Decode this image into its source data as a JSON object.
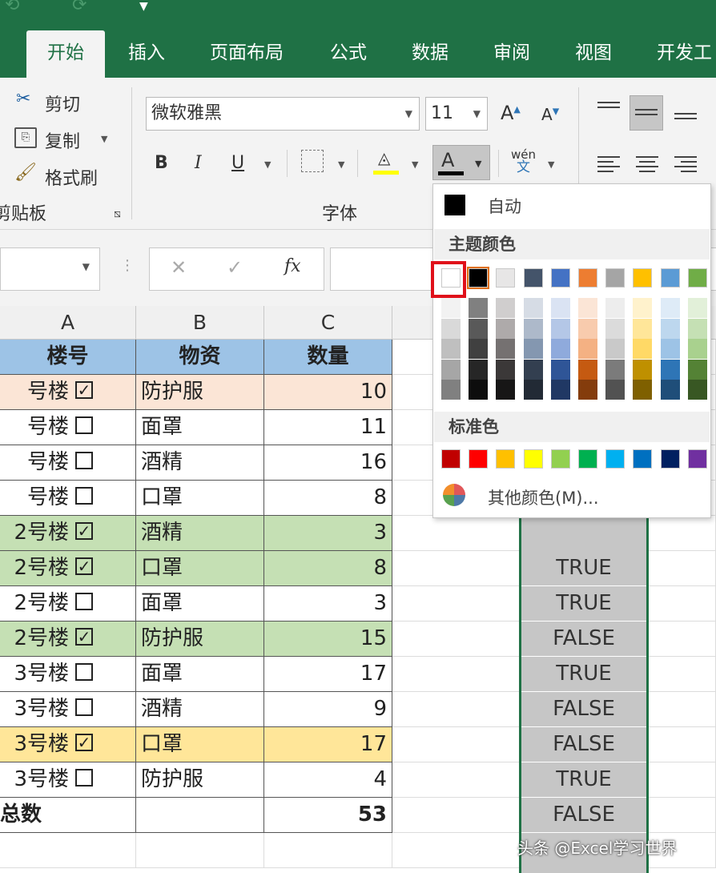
{
  "ribbon": {
    "tabs": [
      "开始",
      "插入",
      "页面布局",
      "公式",
      "数据",
      "审阅",
      "视图",
      "开发工"
    ],
    "clipboard": {
      "cut": "剪切",
      "copy": "复制",
      "format_painter": "格式刷",
      "group_label": "剪贴板"
    },
    "font": {
      "font_name": "微软雅黑",
      "font_size": "11",
      "bold": "B",
      "italic": "I",
      "underline": "U",
      "increase": "A",
      "decrease": "A",
      "font_color": "A",
      "phonetic_top": "wén",
      "phonetic_bottom": "文",
      "group_label": "字体"
    }
  },
  "formula_bar": {
    "cancel": "✕",
    "confirm": "✓",
    "fx": "fx"
  },
  "columns": [
    "A",
    "B",
    "C"
  ],
  "table": {
    "headers": [
      "楼号",
      "物资",
      "数量"
    ],
    "rows": [
      {
        "building": "号楼",
        "checked": true,
        "item": "防护服",
        "qty": "10",
        "bg": "#fbe5d6"
      },
      {
        "building": "号楼",
        "checked": false,
        "item": "面罩",
        "qty": "11",
        "bg": "#ffffff"
      },
      {
        "building": "号楼",
        "checked": false,
        "item": "酒精",
        "qty": "16",
        "bg": "#ffffff"
      },
      {
        "building": "号楼",
        "checked": false,
        "item": "口罩",
        "qty": "8",
        "bg": "#ffffff"
      },
      {
        "building": "2号楼",
        "checked": true,
        "item": "酒精",
        "qty": "3",
        "bg": "#c5e0b4"
      },
      {
        "building": "2号楼",
        "checked": true,
        "item": "口罩",
        "qty": "8",
        "bg": "#c5e0b4"
      },
      {
        "building": "2号楼",
        "checked": false,
        "item": "面罩",
        "qty": "3",
        "bg": "#ffffff"
      },
      {
        "building": "2号楼",
        "checked": true,
        "item": "防护服",
        "qty": "15",
        "bg": "#c5e0b4"
      },
      {
        "building": "3号楼",
        "checked": false,
        "item": "面罩",
        "qty": "17",
        "bg": "#ffffff"
      },
      {
        "building": "3号楼",
        "checked": false,
        "item": "酒精",
        "qty": "9",
        "bg": "#ffffff"
      },
      {
        "building": "3号楼",
        "checked": true,
        "item": "口罩",
        "qty": "17",
        "bg": "#ffe699"
      },
      {
        "building": "3号楼",
        "checked": false,
        "item": "防护服",
        "qty": "4",
        "bg": "#ffffff"
      }
    ],
    "total_label": "总数",
    "total_value": "53"
  },
  "bool_column": [
    "TRUE",
    "TRUE",
    "FALSE",
    "TRUE",
    "FALSE",
    "FALSE",
    "TRUE",
    "FALSE"
  ],
  "color_menu": {
    "auto_label": "自动",
    "theme_label": "主题颜色",
    "standard_label": "标准色",
    "more_label": "其他颜色(M)...",
    "theme_top": [
      "#ffffff",
      "#000000",
      "#e7e6e6",
      "#44546a",
      "#4472c4",
      "#ed7d31",
      "#a5a5a5",
      "#ffc000",
      "#5b9bd5",
      "#70ad47"
    ],
    "theme_shades": [
      [
        "#f2f2f2",
        "#d9d9d9",
        "#bfbfbf",
        "#a6a6a6",
        "#808080"
      ],
      [
        "#808080",
        "#595959",
        "#404040",
        "#262626",
        "#0d0d0d"
      ],
      [
        "#d0cece",
        "#aeaaaa",
        "#757171",
        "#3b3838",
        "#171616"
      ],
      [
        "#d6dce5",
        "#adb9ca",
        "#8497b0",
        "#333f50",
        "#222a35"
      ],
      [
        "#dae3f3",
        "#b4c7e7",
        "#8faadc",
        "#2f5597",
        "#203864"
      ],
      [
        "#fbe5d6",
        "#f8cbad",
        "#f4b183",
        "#c55a11",
        "#843c0c"
      ],
      [
        "#ededed",
        "#dbdbdb",
        "#c9c9c9",
        "#7b7b7b",
        "#525252"
      ],
      [
        "#fff2cc",
        "#ffe699",
        "#ffd966",
        "#bf9000",
        "#7f6000"
      ],
      [
        "#deebf7",
        "#bdd7ee",
        "#9dc3e6",
        "#2e75b6",
        "#1f4e79"
      ],
      [
        "#e2f0d9",
        "#c5e0b4",
        "#a9d18e",
        "#548235",
        "#385723"
      ]
    ],
    "standard": [
      "#c00000",
      "#ff0000",
      "#ffc000",
      "#ffff00",
      "#92d050",
      "#00b050",
      "#00b0f0",
      "#0070c0",
      "#002060",
      "#7030a0"
    ]
  },
  "watermark": "头条 @Excel学习世界"
}
